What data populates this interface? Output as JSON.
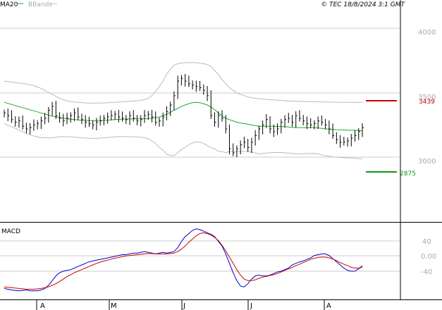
{
  "header": {
    "legend_ma": "MA20",
    "legend_bbands": "BBands",
    "copyright": "© TEC 18/8/2024 3:1 GMT"
  },
  "colors": {
    "ma": "#22aa22",
    "bbands": "#bbbbbb",
    "price": "#000000",
    "macd": "#0000cc",
    "signal": "#cc0000",
    "grid": "#cccccc",
    "resistance": "#cc0000",
    "support": "#119911"
  },
  "chart_data": [
    {
      "type": "line",
      "y_axis_ticks": [
        "4000",
        "3500",
        "3000"
      ],
      "ylim": [
        2500,
        4170
      ],
      "x_tick_labels": [
        "A",
        "M",
        "J",
        "J",
        "A"
      ],
      "levels": [
        {
          "name": "resistance",
          "value": 3439,
          "label": "3439"
        },
        {
          "name": "support",
          "value": 2875,
          "label": "2875"
        }
      ],
      "series": [
        {
          "values": [
            3320,
            3300,
            3270,
            3250,
            3260,
            3220,
            3200,
            3210,
            3230,
            3240,
            3260,
            3280,
            3340,
            3370,
            3300,
            3280,
            3260,
            3280,
            3300,
            3320,
            3290,
            3270,
            3250,
            3240,
            3230,
            3250,
            3260,
            3280,
            3290,
            3300,
            3310,
            3290,
            3280,
            3270,
            3300,
            3280,
            3260,
            3270,
            3300,
            3310,
            3290,
            3250,
            3260,
            3290,
            3330,
            3380,
            3450,
            3560,
            3580,
            3560,
            3540,
            3530,
            3520,
            3510,
            3490,
            3450,
            3300,
            3250,
            3300,
            3280,
            3200,
            3050,
            3020,
            3050,
            3080,
            3100,
            3060,
            3100,
            3150,
            3200,
            3230,
            3270,
            3200,
            3180,
            3200,
            3250,
            3270,
            3280,
            3250,
            3300,
            3280,
            3260,
            3240,
            3230,
            3240,
            3260,
            3250,
            3230,
            3200,
            3150,
            3120,
            3100,
            3100,
            3110,
            3130,
            3150,
            3180,
            3210
          ]
        },
        {
          "values": [
            3400,
            3392,
            3384,
            3376,
            3368,
            3360,
            3352,
            3344,
            3336,
            3328,
            3320,
            3312,
            3304,
            3296,
            3291,
            3286,
            3281,
            3276,
            3273,
            3270,
            3268,
            3265,
            3264,
            3262,
            3262,
            3262,
            3263,
            3265,
            3266,
            3268,
            3270,
            3272,
            3273,
            3274,
            3275,
            3275,
            3276,
            3276,
            3277,
            3278,
            3280,
            3285,
            3290,
            3300,
            3310,
            3325,
            3340,
            3355,
            3370,
            3380,
            3390,
            3397,
            3400,
            3397,
            3390,
            3380,
            3365,
            3345,
            3320,
            3300,
            3280,
            3270,
            3260,
            3250,
            3245,
            3240,
            3235,
            3230,
            3225,
            3220,
            3220,
            3220,
            3220,
            3220,
            3219,
            3218,
            3216,
            3214,
            3212,
            3210,
            3210,
            3210,
            3210,
            3210,
            3210,
            3208,
            3204,
            3200,
            3198,
            3196,
            3194,
            3193,
            3192,
            3191,
            3190,
            3189,
            3188,
            3187
          ]
        },
        {
          "values": [
            3560,
            3556,
            3552,
            3548,
            3545,
            3542,
            3538,
            3532,
            3525,
            3515,
            3505,
            3490,
            3475,
            3460,
            3445,
            3430,
            3420,
            3410,
            3405,
            3402,
            3400,
            3398,
            3396,
            3395,
            3394,
            3394,
            3395,
            3396,
            3397,
            3399,
            3400,
            3402,
            3404,
            3406,
            3408,
            3410,
            3412,
            3415,
            3420,
            3430,
            3450,
            3480,
            3520,
            3560,
            3610,
            3650,
            3680,
            3690,
            3695,
            3698,
            3700,
            3700,
            3698,
            3695,
            3690,
            3685,
            3670,
            3640,
            3610,
            3570,
            3540,
            3510,
            3490,
            3470,
            3460,
            3450,
            3440,
            3435,
            3430,
            3428,
            3425,
            3422,
            3420,
            3418,
            3416,
            3414,
            3412,
            3410,
            3409,
            3408,
            3407,
            3406,
            3405,
            3405,
            3404,
            3404,
            3403,
            3403,
            3402,
            3402,
            3401,
            3401,
            3400,
            3400,
            3400,
            3399,
            3399,
            3399
          ]
        },
        {
          "values": [
            3240,
            3228,
            3216,
            3204,
            3191,
            3178,
            3166,
            3156,
            3147,
            3141,
            3135,
            3134,
            3133,
            3132,
            3137,
            3142,
            3142,
            3142,
            3141,
            3138,
            3136,
            3132,
            3132,
            3129,
            3130,
            3130,
            3131,
            3134,
            3135,
            3137,
            3140,
            3142,
            3142,
            3142,
            3142,
            3140,
            3140,
            3137,
            3134,
            3126,
            3110,
            3090,
            3060,
            3040,
            3010,
            3000,
            3000,
            3020,
            3045,
            3062,
            3080,
            3094,
            3102,
            3099,
            3090,
            3075,
            3060,
            3050,
            3030,
            3030,
            3020,
            3030,
            3030,
            3030,
            3030,
            3030,
            3030,
            3025,
            3020,
            3012,
            3015,
            3018,
            3020,
            3022,
            3022,
            3022,
            3020,
            3018,
            3015,
            3012,
            3013,
            3014,
            3015,
            3015,
            3016,
            3012,
            3005,
            2997,
            2994,
            2990,
            2987,
            2985,
            2984,
            2982,
            2980,
            2979,
            2977,
            2975
          ]
        }
      ]
    },
    {
      "type": "line",
      "title": "MACD",
      "y_axis_ticks": [
        "40",
        "0.00",
        "-40"
      ],
      "ylim": [
        -108,
        86
      ],
      "series": [
        {
          "values": [
            -80,
            -82,
            -84,
            -85,
            -86,
            -85,
            -84,
            -86,
            -86,
            -86,
            -84,
            -80,
            -72,
            -60,
            -48,
            -40,
            -36,
            -34,
            -32,
            -28,
            -24,
            -20,
            -16,
            -12,
            -10,
            -8,
            -6,
            -4,
            -2,
            0,
            2,
            4,
            6,
            6,
            8,
            10,
            10,
            12,
            14,
            12,
            10,
            8,
            10,
            12,
            10,
            12,
            14,
            24,
            40,
            52,
            60,
            68,
            72,
            70,
            66,
            62,
            58,
            52,
            40,
            28,
            8,
            -16,
            -40,
            -60,
            -74,
            -76,
            -68,
            -56,
            -48,
            -46,
            -48,
            -48,
            -46,
            -42,
            -38,
            -36,
            -32,
            -28,
            -20,
            -16,
            -12,
            -10,
            -6,
            -2,
            4,
            6,
            8,
            8,
            4,
            -4,
            -12,
            -20,
            -28,
            -34,
            -36,
            -36,
            -30,
            -22
          ]
        },
        {
          "values": [
            -76,
            -77,
            -78,
            -79,
            -80,
            -81,
            -82,
            -82,
            -82,
            -81,
            -80,
            -78,
            -76,
            -72,
            -68,
            -62,
            -56,
            -50,
            -45,
            -40,
            -36,
            -32,
            -28,
            -24,
            -20,
            -16,
            -13,
            -10,
            -8,
            -5,
            -3,
            -1,
            1,
            3,
            4,
            5,
            6,
            7,
            8,
            9,
            9,
            8,
            8,
            8,
            8,
            9,
            10,
            14,
            20,
            28,
            38,
            46,
            54,
            60,
            62,
            60,
            56,
            50,
            42,
            30,
            16,
            0,
            -16,
            -32,
            -46,
            -56,
            -60,
            -60,
            -58,
            -54,
            -51,
            -49,
            -47,
            -45,
            -42,
            -38,
            -34,
            -30,
            -26,
            -22,
            -18,
            -14,
            -10,
            -6,
            -3,
            -1,
            0,
            0,
            -2,
            -5,
            -9,
            -14,
            -18,
            -22,
            -26,
            -28,
            -28,
            -26
          ]
        }
      ]
    }
  ]
}
